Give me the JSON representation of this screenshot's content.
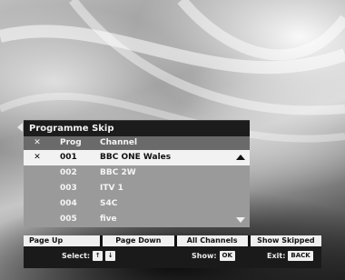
{
  "dialog": {
    "title": "Programme Skip",
    "columns": {
      "skip": "✕",
      "prog": "Prog",
      "channel": "Channel"
    },
    "rows": [
      {
        "skip": "✕",
        "prog": "001",
        "channel": "BBC ONE Wales"
      },
      {
        "skip": "",
        "prog": "002",
        "channel": "BBC 2W"
      },
      {
        "skip": "",
        "prog": "003",
        "channel": "ITV 1"
      },
      {
        "skip": "",
        "prog": "004",
        "channel": "S4C"
      },
      {
        "skip": "",
        "prog": "005",
        "channel": "five"
      }
    ]
  },
  "footer": {
    "buttons": [
      "Page Up",
      "Page Down",
      "All Channels",
      "Show Skipped"
    ],
    "select_label": "Select:",
    "select_keys": [
      "↑",
      "↓"
    ],
    "show_label": "Show:",
    "show_key": "OK",
    "exit_label": "Exit:",
    "exit_key": "BACK"
  },
  "colors": {
    "panel_header": "#1c1c1c",
    "column_header": "#6a6a6a",
    "rows_bg": "#9a9a9a",
    "selected_row": "#f2f2f2"
  }
}
